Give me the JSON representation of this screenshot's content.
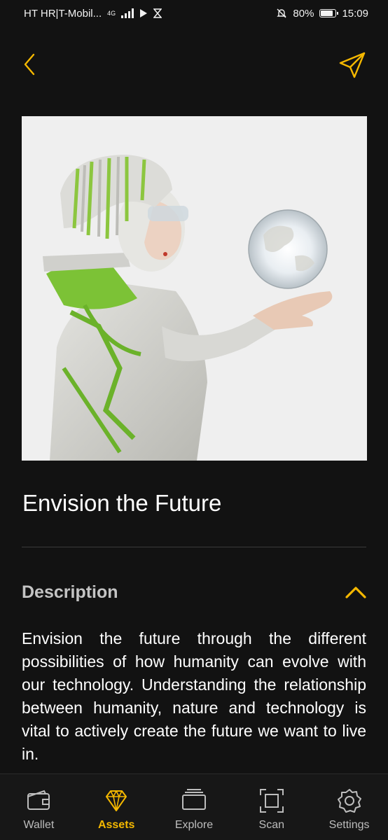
{
  "status_bar": {
    "carrier": "HT HR|T-Mobil...",
    "network": "4G",
    "battery": "80%",
    "time": "15:09"
  },
  "nft": {
    "title": "Envision the Future",
    "description_label": "Description",
    "description": "Envision the future through the different possibilities of how humanity can evolve with our technology. Understanding the relationship between humanity, nature and technology is vital to actively create the future we want to live in."
  },
  "tabs": [
    {
      "label": "Wallet",
      "icon": "wallet-icon",
      "active": false
    },
    {
      "label": "Assets",
      "icon": "diamond-icon",
      "active": true
    },
    {
      "label": "Explore",
      "icon": "stack-icon",
      "active": false
    },
    {
      "label": "Scan",
      "icon": "scan-icon",
      "active": false
    },
    {
      "label": "Settings",
      "icon": "gear-icon",
      "active": false
    }
  ],
  "colors": {
    "background": "#121212",
    "accent": "#f5b800",
    "text": "#ffffff",
    "muted": "#bdbdbd"
  }
}
